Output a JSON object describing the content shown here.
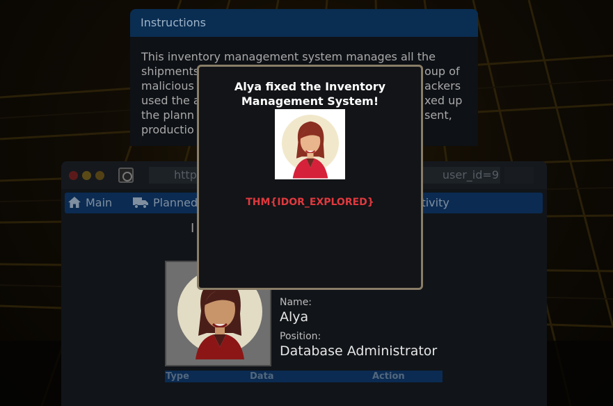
{
  "instructions": {
    "header": "Instructions",
    "visible_lines": [
      "This inventory management system manages all the",
      "shipments",
      "oup of",
      "malicious",
      "ackers",
      "used the a",
      "xed up",
      "the plann",
      "sent,",
      "productio"
    ]
  },
  "browser": {
    "url_prefix": "http",
    "url_suffix": "user_id=9",
    "nav": [
      {
        "label": "Main",
        "icon": "home-icon"
      },
      {
        "label": "Planned",
        "icon": "truck-icon"
      },
      {
        "label": "Activity",
        "icon": ""
      }
    ],
    "title_fragment": "I"
  },
  "profile": {
    "name_label": "Name:",
    "name": "Alya",
    "position_label": "Position:",
    "position": "Database Administrator"
  },
  "table": {
    "columns": [
      "Type",
      "Data",
      "Action"
    ]
  },
  "modal": {
    "title": "Alya fixed the Inventory Management System!",
    "flag": "THM{IDOR_EXPLORED}"
  },
  "colors": {
    "flag": "#e0393e",
    "nav_bg": "#0b2b52",
    "modal_border": "#8a7e68"
  }
}
